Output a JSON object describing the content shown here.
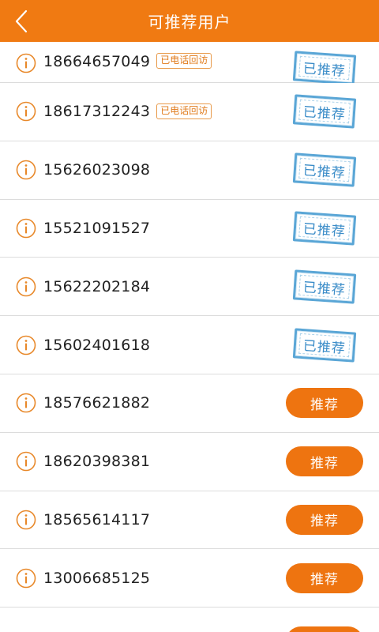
{
  "header": {
    "title": "可推荐用户",
    "back_icon": "chevron-left-icon"
  },
  "colors": {
    "accent": "#f07a12",
    "button": "#ee7410",
    "stamp": "#3a8cc8",
    "tag": "#e07a1a"
  },
  "rows": [
    {
      "phone": "18664657049",
      "tag": "已电话回访",
      "status": "已推荐"
    },
    {
      "phone": "18617312243",
      "tag": "已电话回访",
      "status": "已推荐"
    },
    {
      "phone": "15626023098",
      "status": "已推荐"
    },
    {
      "phone": "15521091527",
      "status": "已推荐"
    },
    {
      "phone": "15622202184",
      "status": "已推荐"
    },
    {
      "phone": "15602401618",
      "status": "已推荐"
    },
    {
      "phone": "18576621882",
      "action": "推荐"
    },
    {
      "phone": "18620398381",
      "action": "推荐"
    },
    {
      "phone": "18565614117",
      "action": "推荐"
    },
    {
      "phone": "13006685125",
      "action": "推荐"
    }
  ]
}
